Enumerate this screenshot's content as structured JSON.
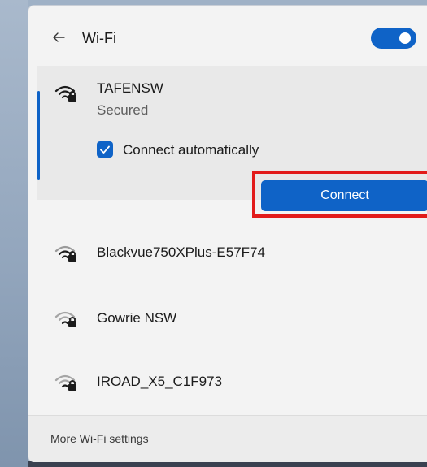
{
  "header": {
    "title": "Wi-Fi",
    "toggle_state": "on"
  },
  "networks": [
    {
      "name": "TAFENSW",
      "status": "Secured",
      "expanded": true,
      "connect_automatically_label": "Connect automatically",
      "connect_automatically_checked": true,
      "connect_button_label": "Connect"
    },
    {
      "name": "Blackvue750XPlus-E57F74"
    },
    {
      "name": "Gowrie NSW"
    },
    {
      "name": "IROAD_X5_C1F973"
    }
  ],
  "footer": {
    "link_label": "More Wi-Fi settings"
  },
  "colors": {
    "accent": "#0f63c7",
    "highlight": "#e21b1b"
  }
}
